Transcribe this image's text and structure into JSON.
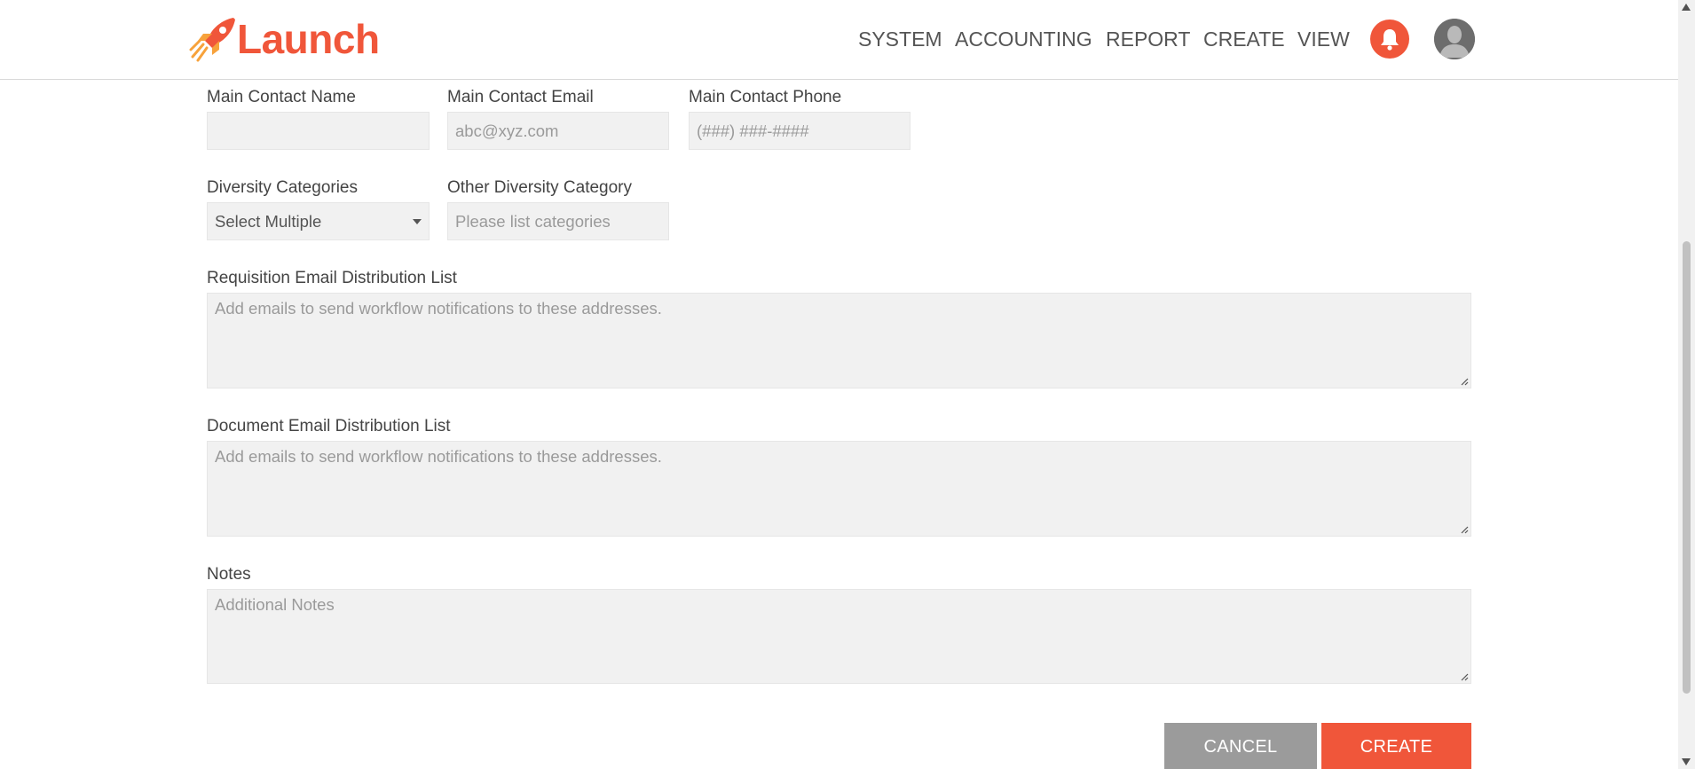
{
  "header": {
    "logo_text": "Launch",
    "nav": [
      "SYSTEM",
      "ACCOUNTING",
      "REPORT",
      "CREATE",
      "VIEW"
    ],
    "notification_icon": "bell-icon",
    "avatar_icon": "user-avatar-icon"
  },
  "form": {
    "main_contact_name": {
      "label": "Main Contact Name",
      "value": "",
      "placeholder": ""
    },
    "main_contact_email": {
      "label": "Main Contact Email",
      "placeholder": "abc@xyz.com"
    },
    "main_contact_phone": {
      "label": "Main Contact Phone",
      "placeholder": "(###) ###-####"
    },
    "diversity_categories": {
      "label": "Diversity Categories",
      "value": "Select Multiple"
    },
    "other_diversity_category": {
      "label": "Other Diversity Category",
      "placeholder": "Please list categories"
    },
    "requisition_email_list": {
      "label": "Requisition Email Distribution List",
      "placeholder": "Add emails to send workflow notifications to these addresses."
    },
    "document_email_list": {
      "label": "Document Email Distribution List",
      "placeholder": "Add emails to send workflow notifications to these addresses."
    },
    "notes": {
      "label": "Notes",
      "placeholder": "Additional Notes"
    }
  },
  "actions": {
    "cancel": "CANCEL",
    "create": "CREATE"
  },
  "colors": {
    "accent": "#f0563a",
    "field_bg": "#f1f1f1",
    "cancel_bg": "#9b9b9b"
  }
}
